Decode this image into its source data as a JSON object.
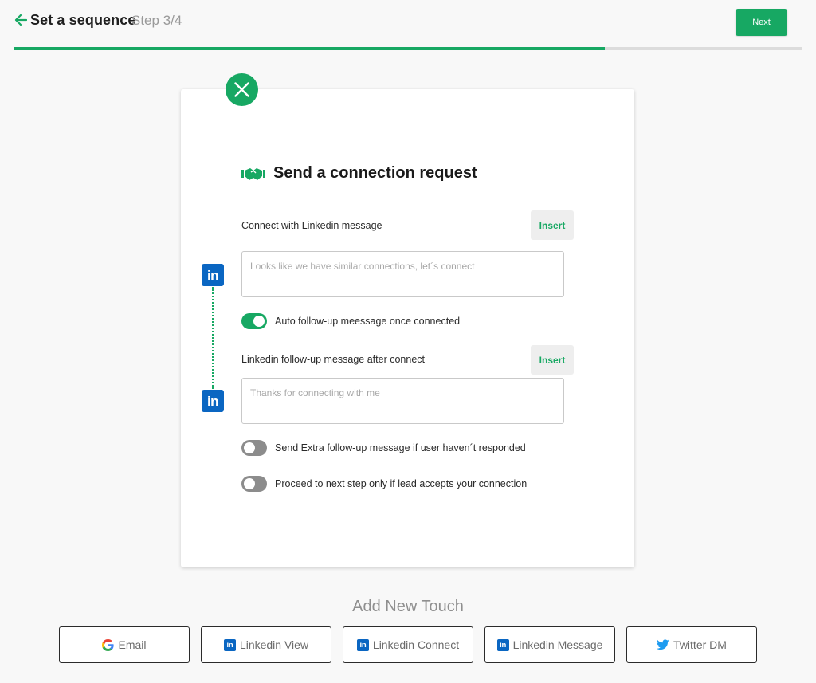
{
  "header": {
    "title": "Set a sequence",
    "step": "Step 3/4",
    "next_label": "Next",
    "progress": 0.75
  },
  "card": {
    "title": "Send a connection request",
    "connect_label": "Connect with Linkedin message",
    "insert_label": "Insert",
    "connect_placeholder": "Looks like we have similar connections, let´s connect",
    "auto_followup_label": "Auto follow-up meessage once connected",
    "auto_followup_on": true,
    "followup_label": "Linkedin follow-up message after connect",
    "followup_placeholder": "Thanks for connecting with me",
    "extra_followup_label": "Send Extra follow-up message if user haven´t responded",
    "extra_followup_on": false,
    "proceed_label": "Proceed to next step only if lead accepts  your connection",
    "proceed_on": false,
    "linkedin_badge": "in"
  },
  "add_touch": {
    "title": "Add New Touch",
    "buttons": [
      {
        "label": "Email",
        "icon": "google-icon"
      },
      {
        "label": "Linkedin View",
        "icon": "linkedin-icon"
      },
      {
        "label": "Linkedin Connect",
        "icon": "linkedin-icon"
      },
      {
        "label": "Linkedin Message",
        "icon": "linkedin-icon"
      },
      {
        "label": "Twitter DM",
        "icon": "twitter-icon"
      }
    ]
  },
  "colors": {
    "accent": "#17a863",
    "linkedin": "#0a66c2",
    "twitter": "#1d9bf0",
    "toggle_off": "#8c8c8c"
  }
}
